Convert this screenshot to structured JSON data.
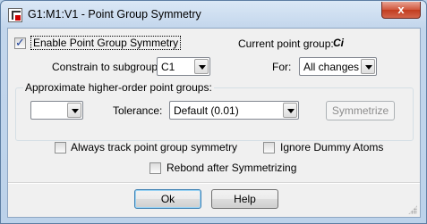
{
  "window": {
    "title": "G1:M1:V1 - Point Group Symmetry",
    "close_glyph": "x",
    "icon": "app-icon"
  },
  "options": {
    "enable_label": "Enable Point Group Symmetry",
    "enable_checked": true,
    "current_pg_label": "Current point group:",
    "current_pg_value": "Ci",
    "constrain_label": "Constrain to subgroup:",
    "constrain_value": "C1",
    "for_label": "For:",
    "for_value": "All changes"
  },
  "approx": {
    "group_label": "Approximate higher-order point groups:",
    "pg_value": "",
    "tolerance_label": "Tolerance:",
    "tolerance_value": "Default (0.01)",
    "symmetrize_label": "Symmetrize"
  },
  "checks": {
    "always_track_label": "Always track point group symmetry",
    "always_track_checked": false,
    "ignore_dummy_label": "Ignore Dummy Atoms",
    "ignore_dummy_checked": false,
    "rebond_label": "Rebond after Symmetrizing",
    "rebond_checked": false
  },
  "buttons": {
    "ok_label": "Ok",
    "help_label": "Help"
  }
}
